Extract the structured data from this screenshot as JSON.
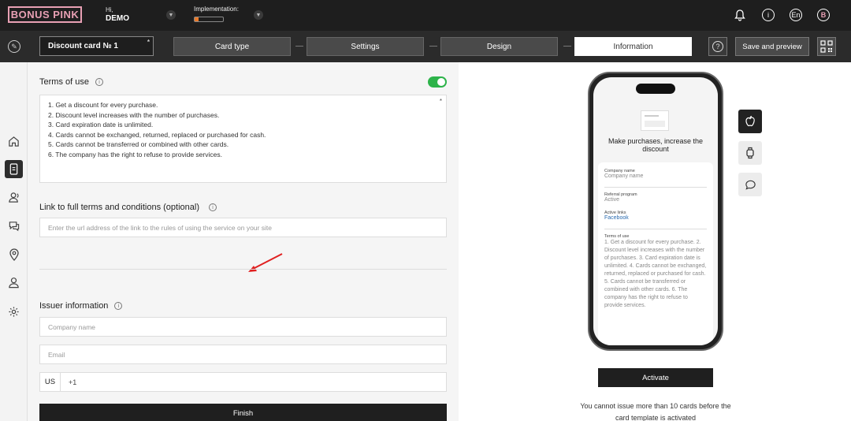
{
  "header": {
    "logo": "BONUS PINK",
    "greeting": "Hi,",
    "user": "DEMO",
    "implementation_label": "Implementation:",
    "implementation_progress": 0.15,
    "language": "En",
    "profile_initial": "B"
  },
  "steps": {
    "card_name": "Discount card № 1",
    "items": [
      "Card type",
      "Settings",
      "Design",
      "Information"
    ],
    "active": "Information",
    "save_label": "Save and preview"
  },
  "form": {
    "terms_label": "Terms of use",
    "terms_lines": [
      "1. Get a discount for every purchase.",
      "2. Discount level increases with the number of purchases.",
      "3. Card expiration date is unlimited.",
      "4. Cards cannot be exchanged, returned, replaced or purchased for cash.",
      "5. Cards cannot be transferred or combined with other cards.",
      "6. The company has the right to refuse to provide services."
    ],
    "link_label": "Link to full terms and conditions (optional)",
    "link_placeholder": "Enter the url address of the link to the rules of using the service on your site",
    "issuer_label": "Issuer information",
    "company_placeholder": "Company name",
    "email_placeholder": "Email",
    "phone_country": "US",
    "phone_prefix": "+1",
    "finish_label": "Finish"
  },
  "preview": {
    "promo_text": "Make purchases, increase the discount",
    "company_label": "Company name",
    "company_value": "Company name",
    "referral_label": "Referral program",
    "referral_value": "Active",
    "links_label": "Active links",
    "links_value": "Facebook",
    "terms_label": "Terms of use",
    "terms_text": "1. Get a discount for every purchase. 2. Discount level increases with the number of purchases. 3. Card expiration date is unlimited. 4. Cards cannot be exchanged, returned, replaced or purchased for cash. 5. Cards cannot be transferred or combined with other cards. 6. The company has the right to refuse to provide services.",
    "activate_label": "Activate",
    "notice": "You cannot issue more than 10 cards before the card template is activated"
  }
}
